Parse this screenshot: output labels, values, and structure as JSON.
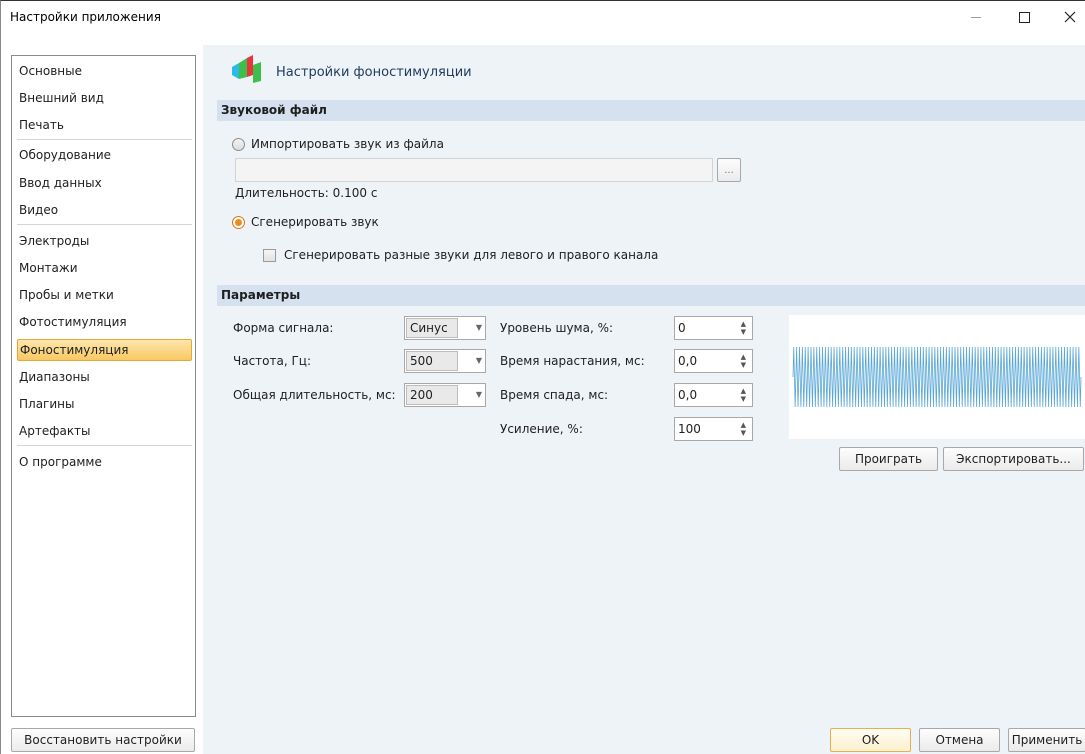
{
  "window": {
    "title": "Настройки приложения"
  },
  "sidebar": {
    "items": [
      {
        "label": "Основные"
      },
      {
        "label": "Внешний вид"
      },
      {
        "label": "Печать"
      },
      {
        "label": "Оборудование"
      },
      {
        "label": "Ввод данных"
      },
      {
        "label": "Видео"
      },
      {
        "label": "Электроды"
      },
      {
        "label": "Монтажи"
      },
      {
        "label": "Пробы и метки"
      },
      {
        "label": "Фотостимуляция"
      },
      {
        "label": "Фоностимуляция",
        "active": true
      },
      {
        "label": "Диапазоны"
      },
      {
        "label": "Плагины"
      },
      {
        "label": "Артефакты"
      },
      {
        "label": "О программе"
      }
    ],
    "restore_label": "Восстановить настройки"
  },
  "page": {
    "title": "Настройки фоностимуляции"
  },
  "sound_file": {
    "section_label": "Звуковой файл",
    "import_label": "Импортировать звук из файла",
    "import_selected": false,
    "file_value": "",
    "browse_label": "...",
    "duration_label": "Длительность: 0.100 с",
    "generate_label": "Сгенерировать звук",
    "generate_selected": true,
    "different_channels_label": "Сгенерировать разные звуки для левого и правого канала",
    "different_channels_checked": false
  },
  "params": {
    "section_label": "Параметры",
    "waveform": {
      "label": "Форма сигнала:",
      "value": "Синус"
    },
    "frequency": {
      "label": "Частота, Гц:",
      "value": "500"
    },
    "total_duration": {
      "label": "Общая длительность, мс:",
      "value": "200"
    },
    "noise_level": {
      "label": "Уровень шума, %:",
      "value": "0"
    },
    "rise_time": {
      "label": "Время нарастания, мс:",
      "value": "0,0"
    },
    "fall_time": {
      "label": "Время спада, мс:",
      "value": "0,0"
    },
    "gain": {
      "label": "Усиление, %:",
      "value": "100"
    },
    "play_label": "Проиграть",
    "export_label": "Экспортировать..."
  },
  "footer": {
    "ok_label": "OK",
    "cancel_label": "Отмена",
    "apply_label": "Применить"
  },
  "colors": {
    "accent": "#f9c862",
    "wave": "#5aa7d6",
    "section_bg": "#d5e1ee",
    "panel_bg": "#eef3f8"
  }
}
